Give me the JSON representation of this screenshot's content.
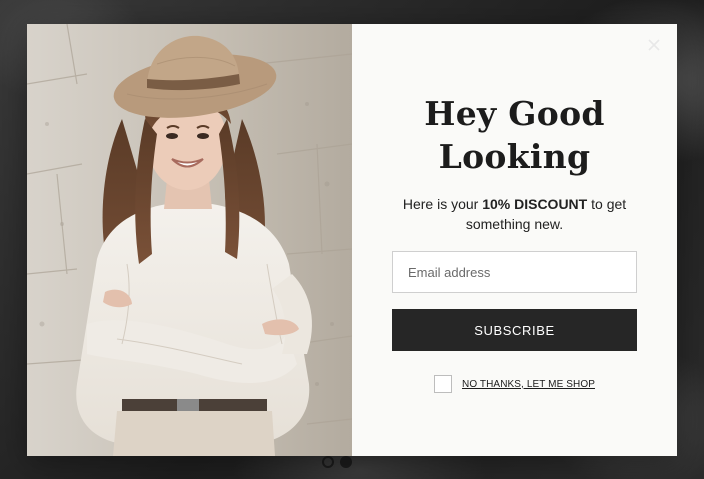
{
  "popup": {
    "title_line1": "Hey Good",
    "title_line2": "Looking",
    "subtitle_pre": "Here is your",
    "subtitle_bold": "10% DISCOUNT",
    "subtitle_post": "to get something new.",
    "email_placeholder": "Email address",
    "email_value": "",
    "subscribe_label": "SUBSCRIBE",
    "decline_label": "NO THANKS, LET ME SHOP",
    "close_icon": "close-icon",
    "photo": "woman-in-hat-photo"
  },
  "background": {
    "slider_dots": [
      {
        "state": "inactive"
      },
      {
        "state": "active"
      }
    ]
  },
  "colors": {
    "button_bg": "#262626",
    "button_text": "#ffffff",
    "panel_bg": "#fafaf8",
    "title": "#1c1c1c"
  }
}
